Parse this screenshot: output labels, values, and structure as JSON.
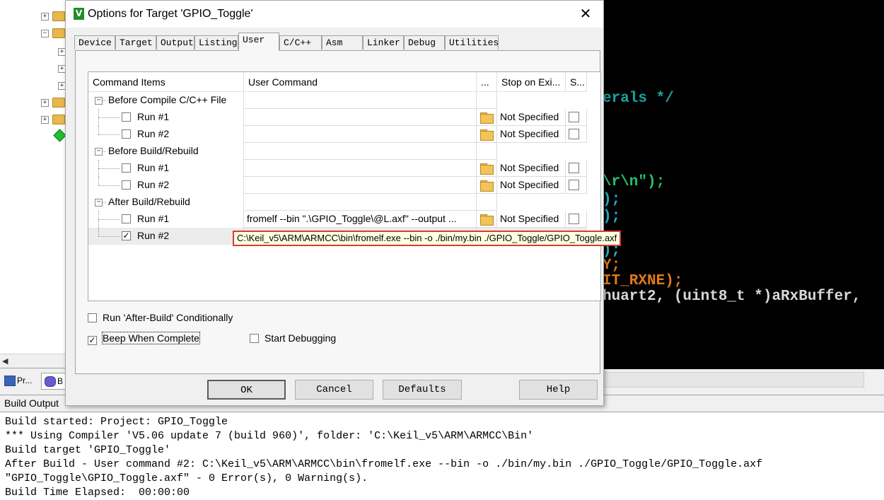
{
  "dialog": {
    "title": "Options for Target 'GPIO_Toggle'",
    "close_glyph": "✕",
    "icon_letter": "V",
    "tabs": [
      "Device",
      "Target",
      "Output",
      "Listing",
      "User",
      "C/C++",
      "Asm",
      "Linker",
      "Debug",
      "Utilities"
    ],
    "active_tab": "User"
  },
  "grid": {
    "headers": [
      "Command Items",
      "User Command",
      "...",
      "Stop on Exi...",
      "S..."
    ],
    "groups": [
      {
        "label": "Before Compile C/C++ File",
        "items": [
          {
            "label": "Run #1",
            "checked": false,
            "command": "",
            "stop": "Not Specified"
          },
          {
            "label": "Run #2",
            "checked": false,
            "command": "",
            "stop": "Not Specified"
          }
        ]
      },
      {
        "label": "Before Build/Rebuild",
        "items": [
          {
            "label": "Run #1",
            "checked": false,
            "command": "",
            "stop": "Not Specified"
          },
          {
            "label": "Run #2",
            "checked": false,
            "command": "",
            "stop": "Not Specified"
          }
        ]
      },
      {
        "label": "After Build/Rebuild",
        "items": [
          {
            "label": "Run #1",
            "checked": false,
            "command": "fromelf --bin \".\\GPIO_Toggle\\@L.axf\" --output ...",
            "stop": "Not Specified"
          },
          {
            "label": "Run #2",
            "checked": true,
            "command": "",
            "stop": ""
          }
        ]
      }
    ],
    "tooltip": "C:\\Keil_v5\\ARM\\ARMCC\\bin\\fromelf.exe --bin -o ./bin/my.bin ./GPIO_Toggle/GPIO_Toggle.axf"
  },
  "options": {
    "run_after_build": {
      "label": "Run 'After-Build' Conditionally",
      "checked": false
    },
    "beep": {
      "label": "Beep When Complete",
      "checked": true
    },
    "start_debugging": {
      "label": "Start Debugging",
      "checked": false
    }
  },
  "buttons": {
    "ok": "OK",
    "cancel": "Cancel",
    "defaults": "Defaults",
    "help": "Help"
  },
  "project_tabs": [
    "Pr...",
    "B"
  ],
  "editor": {
    "lines": [
      {
        "text": "erals */",
        "color": "#1aa3a0"
      },
      {
        "text": "\\r\\n\");",
        "color": "#22c26a"
      },
      {
        "text": ");",
        "color": "#20b8c8"
      },
      {
        "text": ");",
        "color": "#20b8c8"
      },
      {
        "text": ");",
        "color": "#20b8c8"
      },
      {
        "text": "Y;",
        "color": "#e07a1a"
      },
      {
        "text": "IT_RXNE);",
        "color": "#e07a1a"
      },
      {
        "text": "huart2, (uint8_t *)aRxBuffer,",
        "color": "#d8d8d8"
      }
    ]
  },
  "build_output": {
    "title": "Build Output",
    "lines": [
      "Build started: Project: GPIO_Toggle",
      "*** Using Compiler 'V5.06 update 7 (build 960)', folder: 'C:\\Keil_v5\\ARM\\ARMCC\\Bin'",
      "Build target 'GPIO_Toggle'",
      "After Build - User command #2: C:\\Keil_v5\\ARM\\ARMCC\\bin\\fromelf.exe --bin -o ./bin/my.bin ./GPIO_Toggle/GPIO_Toggle.axf",
      "\"GPIO_Toggle\\GPIO_Toggle.axf\" - 0 Error(s), 0 Warning(s).",
      "Build Time Elapsed:  00:00:00"
    ]
  },
  "colors": {
    "accent_border": "#d63a3a",
    "tooltip_bg": "#ffffe1",
    "editor_bg": "#000000"
  }
}
